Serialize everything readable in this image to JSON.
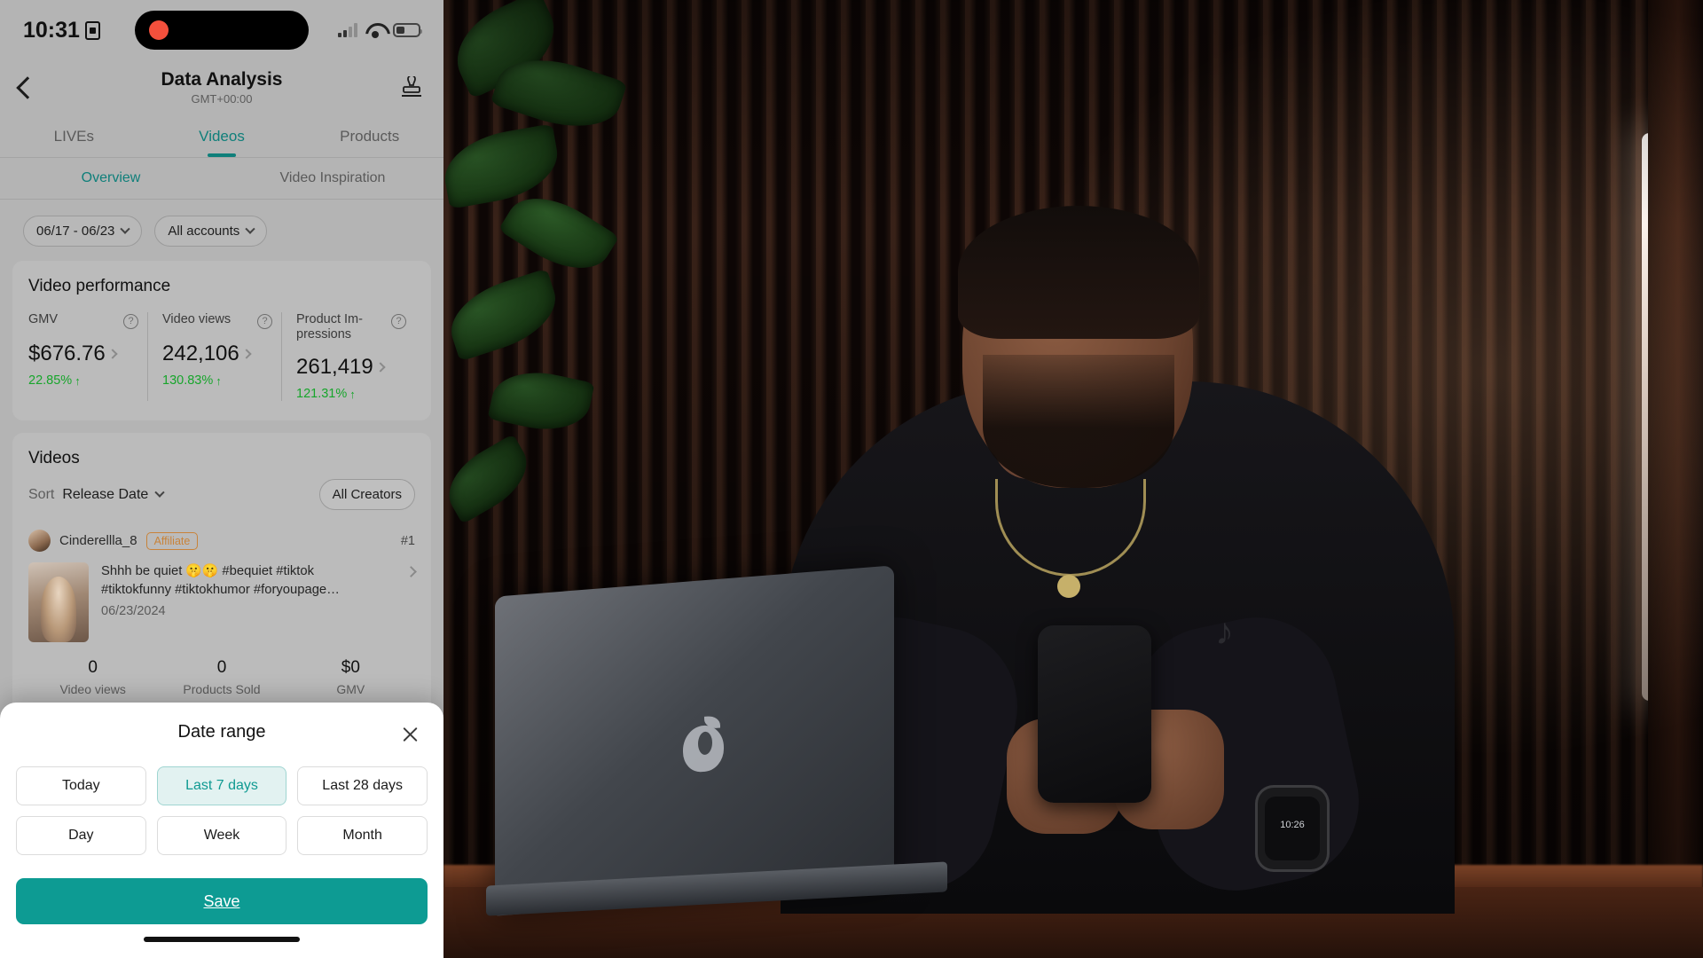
{
  "status_bar": {
    "time": "10:31",
    "record_icon": "screen-record-icon",
    "cellular_icon": "cellular-bars-icon",
    "wifi_icon": "wifi-icon",
    "battery_icon": "battery-icon"
  },
  "nav": {
    "back_icon": "back-chevron-icon",
    "title": "Data Analysis",
    "subtitle": "GMT+00:00",
    "action_icon": "stamp-icon"
  },
  "tabs_main": [
    {
      "label": "LIVEs",
      "active": false
    },
    {
      "label": "Videos",
      "active": true
    },
    {
      "label": "Products",
      "active": false
    }
  ],
  "tabs_sub": [
    {
      "label": "Overview",
      "active": true
    },
    {
      "label": "Video Inspiration",
      "active": false
    }
  ],
  "filters": [
    {
      "label": "06/17 - 06/23",
      "icon": "chevron-down-icon"
    },
    {
      "label": "All accounts",
      "icon": "chevron-down-icon"
    }
  ],
  "video_performance": {
    "title": "Video performance",
    "metrics": [
      {
        "label": "GMV",
        "value": "$676.76",
        "delta": "22.85%",
        "trend": "up",
        "help_icon": "question-mark-icon"
      },
      {
        "label": "Video views",
        "value": "242,106",
        "delta": "130.83%",
        "trend": "up",
        "help_icon": "question-mark-icon"
      },
      {
        "label": "Product Im-\npressions",
        "label_l1": "Product Im-",
        "label_l2": "pressions",
        "value": "261,419",
        "delta": "121.31%",
        "trend": "up",
        "help_icon": "question-mark-icon"
      }
    ]
  },
  "videos": {
    "title": "Videos",
    "sort_label": "Sort",
    "sort_value": "Release Date",
    "creators_filter": "All Creators",
    "items": [
      {
        "creator": "Cinderellla_8",
        "badge": "Affiliate",
        "rank": "#1",
        "caption_line1": "Shhh be quiet 🤫🤫 #bequiet #tiktok",
        "caption_line2": "#tiktokfunny #tiktokhumor #foryoupage…",
        "date": "06/23/2024",
        "stats": [
          {
            "value": "0",
            "label": "Video views"
          },
          {
            "value": "0",
            "label": "Products Sold"
          },
          {
            "value": "$0",
            "label": "GMV"
          }
        ]
      }
    ]
  },
  "date_sheet": {
    "title": "Date range",
    "close_icon": "close-icon",
    "options": [
      {
        "label": "Today",
        "selected": false
      },
      {
        "label": "Last 7 days",
        "selected": true
      },
      {
        "label": "Last 28 days",
        "selected": false
      },
      {
        "label": "Day",
        "selected": false
      },
      {
        "label": "Week",
        "selected": false
      },
      {
        "label": "Month",
        "selected": false
      }
    ],
    "save_label": "Save"
  },
  "scene": {
    "watch_time": "10:26",
    "tiktok_logo": "♪"
  },
  "colors": {
    "accent_teal": "#0f7f7a",
    "save_button": "#0d9b93",
    "positive_green": "#17a52b",
    "affiliate_orange": "#c8833a",
    "selected_bg": "#e2f2f1"
  }
}
